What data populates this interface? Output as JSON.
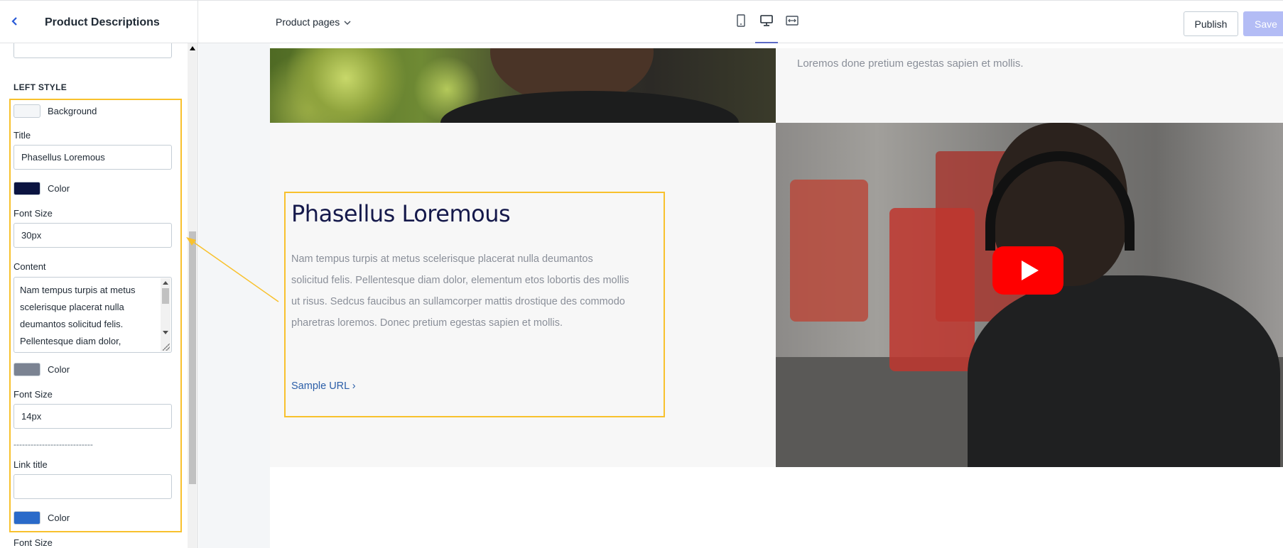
{
  "header": {
    "title": "Product Descriptions",
    "page_select": "Product pages",
    "publish_label": "Publish",
    "save_label": "Save"
  },
  "sidebar": {
    "section_title": "LEFT STYLE",
    "background_label": "Background",
    "background_color": "#f4f6f8",
    "title_label": "Title",
    "title_value": "Phasellus Loremous",
    "title_color_label": "Color",
    "title_color": "#0b1441",
    "title_font_size_label": "Font Size",
    "title_font_size": "30px",
    "content_label": "Content",
    "content_value": "Nam tempus turpis at metus scelerisque placerat nulla deumantos solicitud felis. Pellentesque diam dolor,",
    "content_color_label": "Color",
    "content_color": "#7b8392",
    "content_font_size_label": "Font Size",
    "content_font_size": "14px",
    "divider": "----------------------------",
    "link_title_label": "Link title",
    "link_title_value": "",
    "link_color_label": "Color",
    "link_color": "#2a6ac9",
    "link_font_size_label": "Font Size"
  },
  "preview": {
    "top_right_text": "Loremos done pretium egestas sapien et mollis.",
    "content_title": "Phasellus Loremous",
    "content_body": "Nam tempus turpis at metus scelerisque placerat nulla deumantos solicitud felis. Pellentesque diam dolor, elementum etos lobortis des mollis ut risus. Sedcus faucibus an sullamcorper mattis drostique des commodo pharetras loremos. Donec pretium egestas sapien et mollis.",
    "content_link": "Sample URL ›"
  },
  "colors": {
    "accent": "#5c6ac4",
    "highlight": "#f8c12d",
    "save_disabled": "#b3bcf5"
  }
}
